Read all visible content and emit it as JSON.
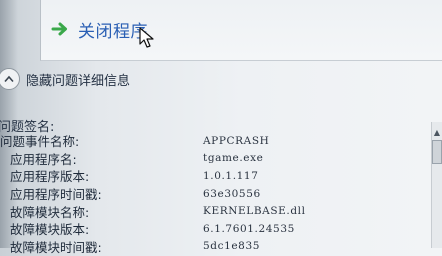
{
  "actions": {
    "close_program_label": "关闭程序"
  },
  "details_toggle": {
    "label": "隐藏问题详细信息"
  },
  "signature": {
    "title": "问题签名:",
    "rows": [
      {
        "key": "问题事件名称:",
        "value": "APPCRASH"
      },
      {
        "key": "应用程序名:",
        "value": "tgame.exe"
      },
      {
        "key": "应用程序版本:",
        "value": "1.0.1.117"
      },
      {
        "key": "应用程序时间戳:",
        "value": "63e30556"
      },
      {
        "key": "故障模块名称:",
        "value": "KERNELBASE.dll"
      },
      {
        "key": "故障模块版本:",
        "value": "6.1.7601.24535"
      },
      {
        "key": "故障模块时间戳:",
        "value": "5dc1e835"
      }
    ]
  },
  "icons": {
    "close_arrow": "green-right-arrow-icon",
    "toggle": "chevron-up-icon",
    "cursor": "mouse-pointer-icon"
  },
  "colors": {
    "link": "#2a5fb4",
    "arrow": "#3aa84a"
  }
}
